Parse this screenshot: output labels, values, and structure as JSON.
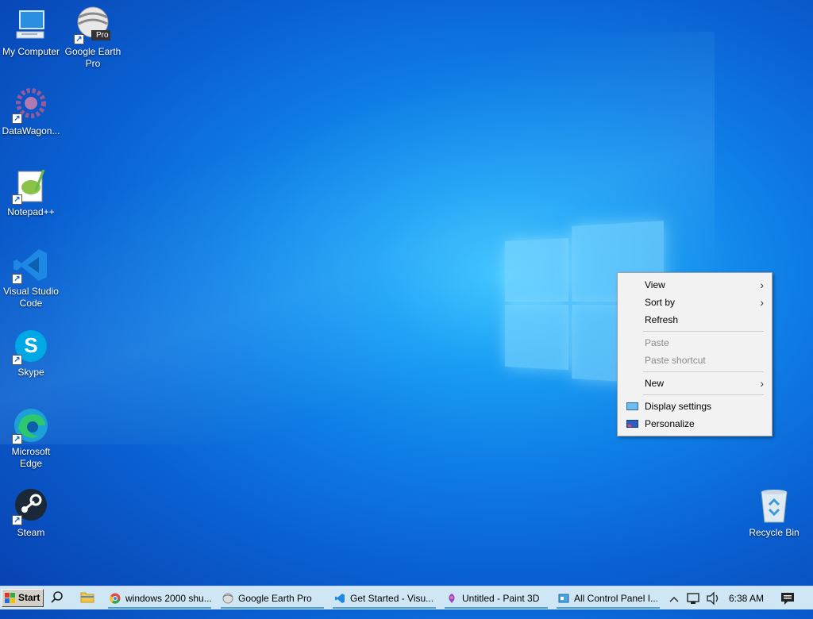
{
  "desktop": {
    "icons": [
      {
        "label": "My Computer",
        "icon": "computer-icon"
      },
      {
        "label": "Google Earth Pro",
        "icon": "google-earth-icon",
        "badge": "Pro"
      },
      {
        "label": "DataWagon...",
        "icon": "datawagon-icon"
      },
      {
        "label": "Notepad++",
        "icon": "notepadpp-icon"
      },
      {
        "label": "Visual Studio Code",
        "icon": "vscode-icon"
      },
      {
        "label": "Skype",
        "icon": "skype-icon",
        "glyph": "S"
      },
      {
        "label": "Microsoft Edge",
        "icon": "edge-icon"
      },
      {
        "label": "Steam",
        "icon": "steam-icon"
      },
      {
        "label": "Recycle Bin",
        "icon": "recycle-bin-icon"
      }
    ]
  },
  "context_menu": {
    "view": "View",
    "sort_by": "Sort by",
    "refresh": "Refresh",
    "paste": "Paste",
    "paste_shortcut": "Paste shortcut",
    "new": "New",
    "display_settings": "Display settings",
    "personalize": "Personalize"
  },
  "taskbar": {
    "start_label": "Start",
    "tasks": [
      {
        "label": "windows 2000 shu...",
        "icon": "chrome-icon"
      },
      {
        "label": "Google Earth Pro",
        "icon": "google-earth-icon"
      },
      {
        "label": "Get Started - Visu...",
        "icon": "vscode-icon"
      },
      {
        "label": "Untitled - Paint 3D",
        "icon": "paint3d-icon"
      },
      {
        "label": "All Control Panel I...",
        "icon": "control-panel-icon"
      }
    ],
    "clock": "6:38 AM"
  },
  "colors": {
    "desktop_accent": "#0f7ee6",
    "taskbar_bg": "#cfe6f5",
    "menu_bg": "#f2f2f2"
  }
}
